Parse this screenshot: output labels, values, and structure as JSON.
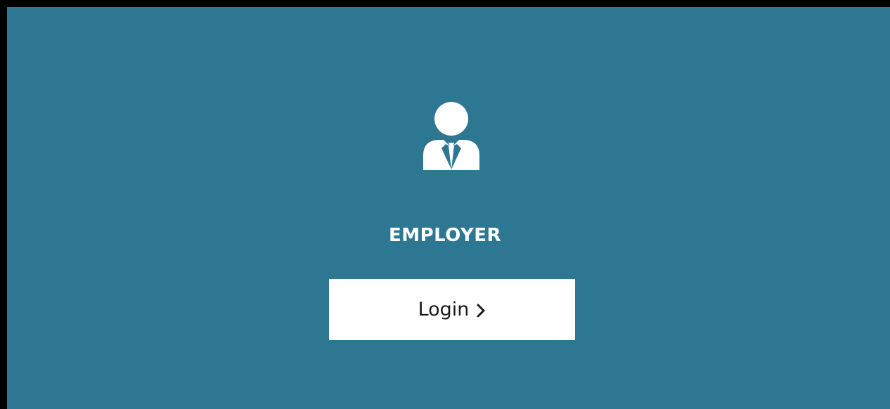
{
  "theme": {
    "background": "#000000",
    "panel": "#2e7793",
    "button_bg": "#ffffff",
    "text_light": "#ffffff",
    "text_dark": "#1a1a1a"
  },
  "card": {
    "icon": "user-tie-icon",
    "title": "EMPLOYER"
  },
  "login_button": {
    "label": "Login",
    "icon": "chevron-right-icon"
  }
}
